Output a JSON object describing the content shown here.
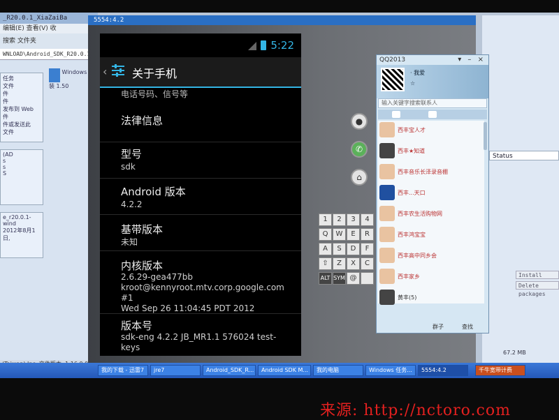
{
  "explorer": {
    "title": "_R20.0.1_XiaZaiBa",
    "menu": "编辑(E)  查看(V)  收",
    "toolbar": "搜索  文件夹",
    "address": "WNLOAD\\Android_SDK_R20.0.1_XiaZaiBa",
    "panel1": [
      "任务",
      "文件",
      "件",
      "件",
      "发布到 Web",
      "件",
      "件或发送此",
      "文件"
    ],
    "panel2": [
      "(AD",
      "s",
      "s",
      "S"
    ],
    "panel3_name": "e_r20.0.1-wind",
    "panel3_date": "2012年8月1日,",
    "file_name": "Windows 安装 1.50",
    "status": "(Taiwan) Inc. 文件版本: 1.16.0.0 创建日期: 2012-0"
  },
  "sdk_manager": {
    "status_label": "Status",
    "install_button": "Install packages",
    "delete_button": "Delete packages",
    "bottom_text": "67.2 MB"
  },
  "emulator": {
    "title": "5554:4.2",
    "status_bar": {
      "time": "5:22"
    },
    "action_bar": {
      "title": "关于手机"
    },
    "partial_row": "电话号码、信号等",
    "rows": [
      {
        "title": "法律信息",
        "summary": ""
      },
      {
        "title": "型号",
        "summary": "sdk"
      },
      {
        "title": "Android 版本",
        "summary": "4.2.2"
      },
      {
        "title": "基带版本",
        "summary": "未知"
      },
      {
        "title": "内核版本",
        "summary": "2.6.29-gea477bb\nkroot@kennyroot.mtv.corp.google.com\n#1\nWed Sep 26 11:04:45 PDT 2012"
      },
      {
        "title": "版本号",
        "summary": "sdk-eng 4.2.2 JB_MR1.1 576024 test-\nkeys"
      }
    ],
    "controls": {
      "camera_icon": "●",
      "call_icon": "✆",
      "home_icon": "⌂"
    },
    "keys": {
      "row1": [
        "1",
        "2",
        "3",
        "4"
      ],
      "row2": [
        "Q",
        "W",
        "E",
        "R"
      ],
      "row3": [
        "A",
        "S",
        "D",
        "F"
      ],
      "row4": [
        "⇧",
        "Z",
        "X",
        "C"
      ],
      "row5": [
        "ALT",
        "SYM",
        "@",
        ""
      ]
    }
  },
  "qq": {
    "window_title": "QQ2013",
    "window_buttons": "▾ – ×",
    "nickname": "· 我爱 ",
    "signature": "☆",
    "search_placeholder": "输入关键字搜索联系人",
    "contacts": [
      {
        "name": "西丰宝人才"
      },
      {
        "name": "西丰★知道"
      },
      {
        "name": "西丰音乐长泽录音棚"
      },
      {
        "name": "西丰...天口"
      },
      {
        "name": "西丰农生活购物网"
      },
      {
        "name": "西丰鸿宝宝"
      },
      {
        "name": "西丰高中同乡会"
      },
      {
        "name": "西丰家乡"
      },
      {
        "name": "黄丰(5)"
      }
    ],
    "footer": {
      "group_label": "群子",
      "find_label": "查找"
    }
  },
  "taskbar": {
    "items": [
      "我的下载 - 迅雷7",
      "jre7",
      "Android_SDK_R...",
      "Android SDK M...",
      "我的电脑",
      "Windows 任务...",
      "5554:4.2",
      "千牛宽带计费"
    ]
  },
  "watermark": "来源: http://nctoro.com"
}
